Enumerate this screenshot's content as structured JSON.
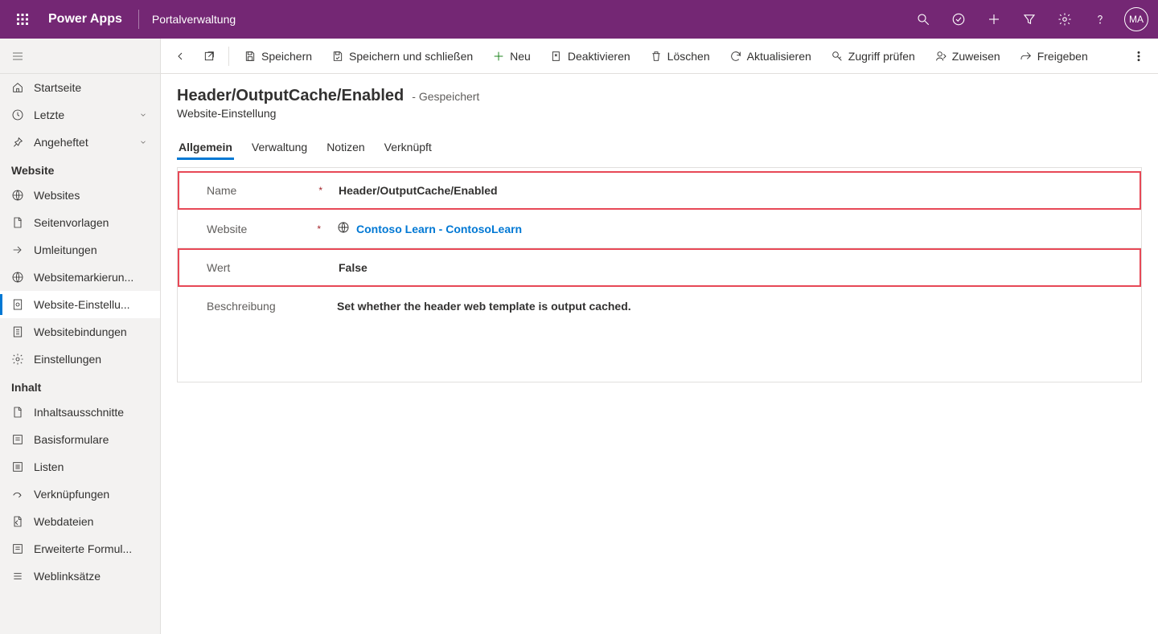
{
  "topbar": {
    "brand": "Power Apps",
    "portal": "Portalverwaltung",
    "avatar": "MA"
  },
  "sidebar": {
    "top": [
      {
        "label": "Startseite",
        "icon": "home"
      },
      {
        "label": "Letzte",
        "icon": "clock",
        "chevron": true
      },
      {
        "label": "Angeheftet",
        "icon": "pin",
        "chevron": true
      }
    ],
    "groups": [
      {
        "title": "Website",
        "items": [
          {
            "label": "Websites",
            "icon": "globe"
          },
          {
            "label": "Seitenvorlagen",
            "icon": "page"
          },
          {
            "label": "Umleitungen",
            "icon": "redirect"
          },
          {
            "label": "Websitemarkierun...",
            "icon": "globe"
          },
          {
            "label": "Website-Einstellu...",
            "icon": "settings-doc",
            "selected": true
          },
          {
            "label": "Websitebindungen",
            "icon": "binding"
          },
          {
            "label": "Einstellungen",
            "icon": "gear"
          }
        ]
      },
      {
        "title": "Inhalt",
        "items": [
          {
            "label": "Inhaltsausschnitte",
            "icon": "page"
          },
          {
            "label": "Basisformulare",
            "icon": "form"
          },
          {
            "label": "Listen",
            "icon": "list"
          },
          {
            "label": "Verknüpfungen",
            "icon": "shortcut"
          },
          {
            "label": "Webdateien",
            "icon": "file"
          },
          {
            "label": "Erweiterte Formul...",
            "icon": "form"
          },
          {
            "label": "Weblinksätze",
            "icon": "links"
          }
        ]
      }
    ]
  },
  "cmdbar": {
    "save": "Speichern",
    "saveclose": "Speichern und schließen",
    "new": "Neu",
    "deactivate": "Deaktivieren",
    "delete": "Löschen",
    "refresh": "Aktualisieren",
    "access": "Zugriff prüfen",
    "assign": "Zuweisen",
    "share": "Freigeben"
  },
  "record": {
    "title": "Header/OutputCache/Enabled",
    "status": "- Gespeichert",
    "subtitle": "Website-Einstellung",
    "tabs": [
      "Allgemein",
      "Verwaltung",
      "Notizen",
      "Verknüpft"
    ],
    "fields": {
      "name_label": "Name",
      "name_value": "Header/OutputCache/Enabled",
      "website_label": "Website",
      "website_value": "Contoso Learn - ContosoLearn",
      "wert_label": "Wert",
      "wert_value": "False",
      "desc_label": "Beschreibung",
      "desc_value": "Set whether the header web template is output cached."
    }
  }
}
